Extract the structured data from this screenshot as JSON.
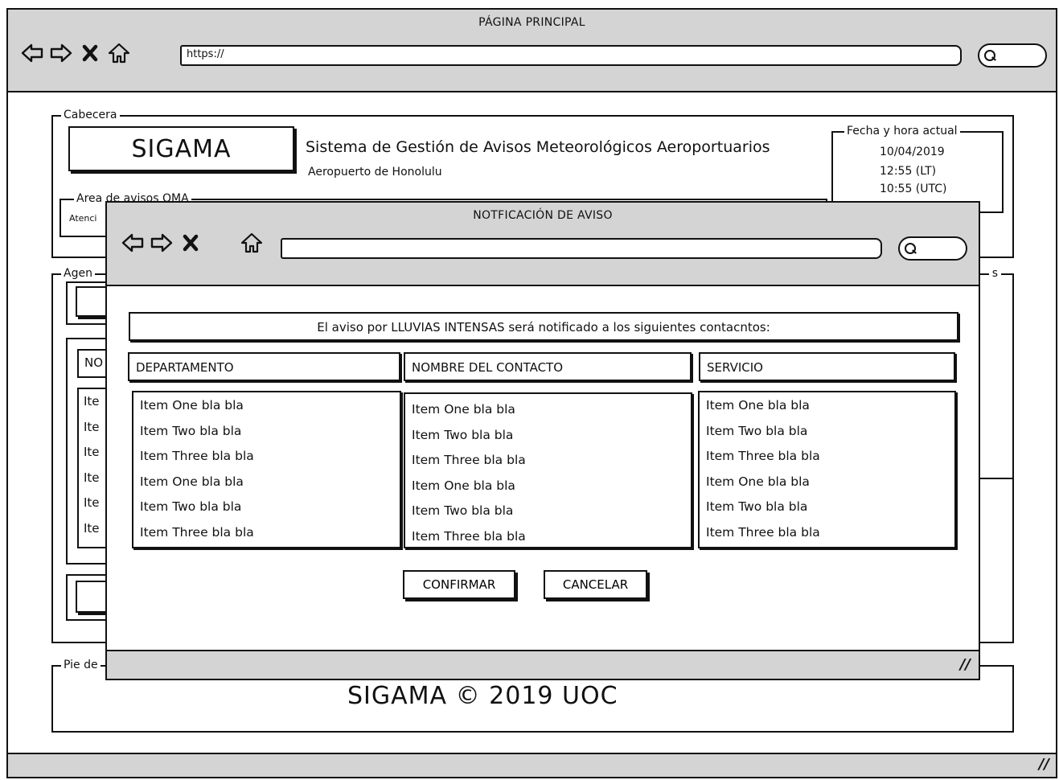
{
  "outer": {
    "title": "PÁGINA PRINCIPAL",
    "url": "https://"
  },
  "header": {
    "legend": "Cabecera",
    "logo": "SIGAMA",
    "system_name": "Sistema de Gestión de Avisos Meteorológicos Aeroportuarios",
    "airport": "Aeropuerto de Honolulu",
    "datetime": {
      "legend": "Fecha y hora actual",
      "date": "10/04/2019",
      "local_time": "12:55 (LT)",
      "utc_time": "10:55 (UTC)"
    },
    "oma_area": {
      "legend": "Area de avisos OMA",
      "text": "Atenci"
    }
  },
  "agenda": {
    "legend": "Agen",
    "right_legend_fragment": "s",
    "table_header_fragment": "NO",
    "items": [
      "Ite",
      "Ite",
      "Ite",
      "Ite",
      "Ite",
      "Ite"
    ]
  },
  "footer": {
    "legend": "Pie de",
    "text": "SIGAMA © 2019 UOC"
  },
  "modal": {
    "title": "NOTFICACIÓN DE AVISO",
    "url": "",
    "message": "El aviso por LLUVIAS INTENSAS será notificado a los siguientes contacntos:",
    "columns": [
      {
        "header": "DEPARTAMENTO",
        "items": [
          "Item One bla bla",
          "Item Two bla bla",
          "Item Three bla bla",
          "Item One bla bla",
          "Item Two bla bla",
          "Item Three bla bla"
        ]
      },
      {
        "header": "NOMBRE DEL CONTACTO",
        "items": [
          "Item One bla bla",
          "Item Two bla bla",
          "Item Three bla bla",
          "Item One bla bla",
          "Item Two bla bla",
          "Item Three bla bla"
        ]
      },
      {
        "header": "SERVICIO",
        "items": [
          "Item One bla bla",
          "Item Two bla bla",
          "Item Three bla bla",
          "Item One bla bla",
          "Item Two bla bla",
          "Item Three bla bla"
        ]
      }
    ],
    "confirm_label": "CONFIRMAR",
    "cancel_label": "CANCELAR"
  },
  "icons": {
    "back": "arrow-left-icon",
    "forward": "arrow-right-icon",
    "stop": "close-icon",
    "home": "home-icon",
    "search": "search-icon",
    "resize": "resize-grip-icon"
  }
}
